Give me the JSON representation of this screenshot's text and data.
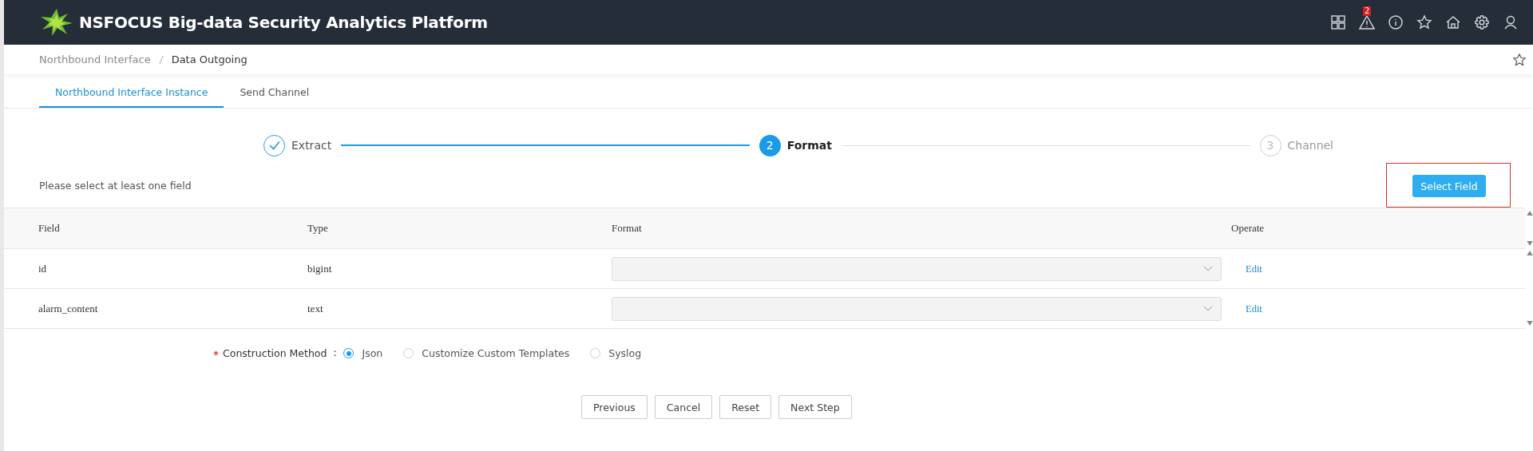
{
  "header": {
    "title": "NSFOCUS Big-data Security Analytics Platform",
    "alert_count": "2"
  },
  "breadcrumb": [
    "Northbound Interface",
    "Data Outgoing"
  ],
  "tabs": [
    {
      "label": "Northbound Interface Instance",
      "selected": true
    },
    {
      "label": "Send Channel",
      "selected": false
    }
  ],
  "steps": [
    {
      "label": "Extract",
      "completed": true,
      "current": false
    },
    {
      "number": "2",
      "label": "Format",
      "completed": false,
      "current": true
    },
    {
      "number": "3",
      "label": "Channel",
      "completed": false,
      "current": false
    }
  ],
  "hint": "Please select at least one field",
  "select_button": "Select Field",
  "table": {
    "columns": [
      "Field",
      "Type",
      "Format",
      "Operate"
    ],
    "rows": [
      {
        "field": "id",
        "type": "bigint",
        "action": "Edit"
      },
      {
        "field": "alarm_content",
        "type": "text",
        "action": "Edit"
      }
    ]
  },
  "construction": {
    "required": true,
    "label": "Construction Method",
    "separator": "：",
    "options": [
      {
        "label": "Json",
        "selected": true
      },
      {
        "label": "Customize Custom Templates",
        "selected": false
      },
      {
        "label": "Syslog",
        "selected": false
      }
    ]
  },
  "buttons": [
    "Previous",
    "Cancel",
    "Reset",
    "Next Step"
  ]
}
